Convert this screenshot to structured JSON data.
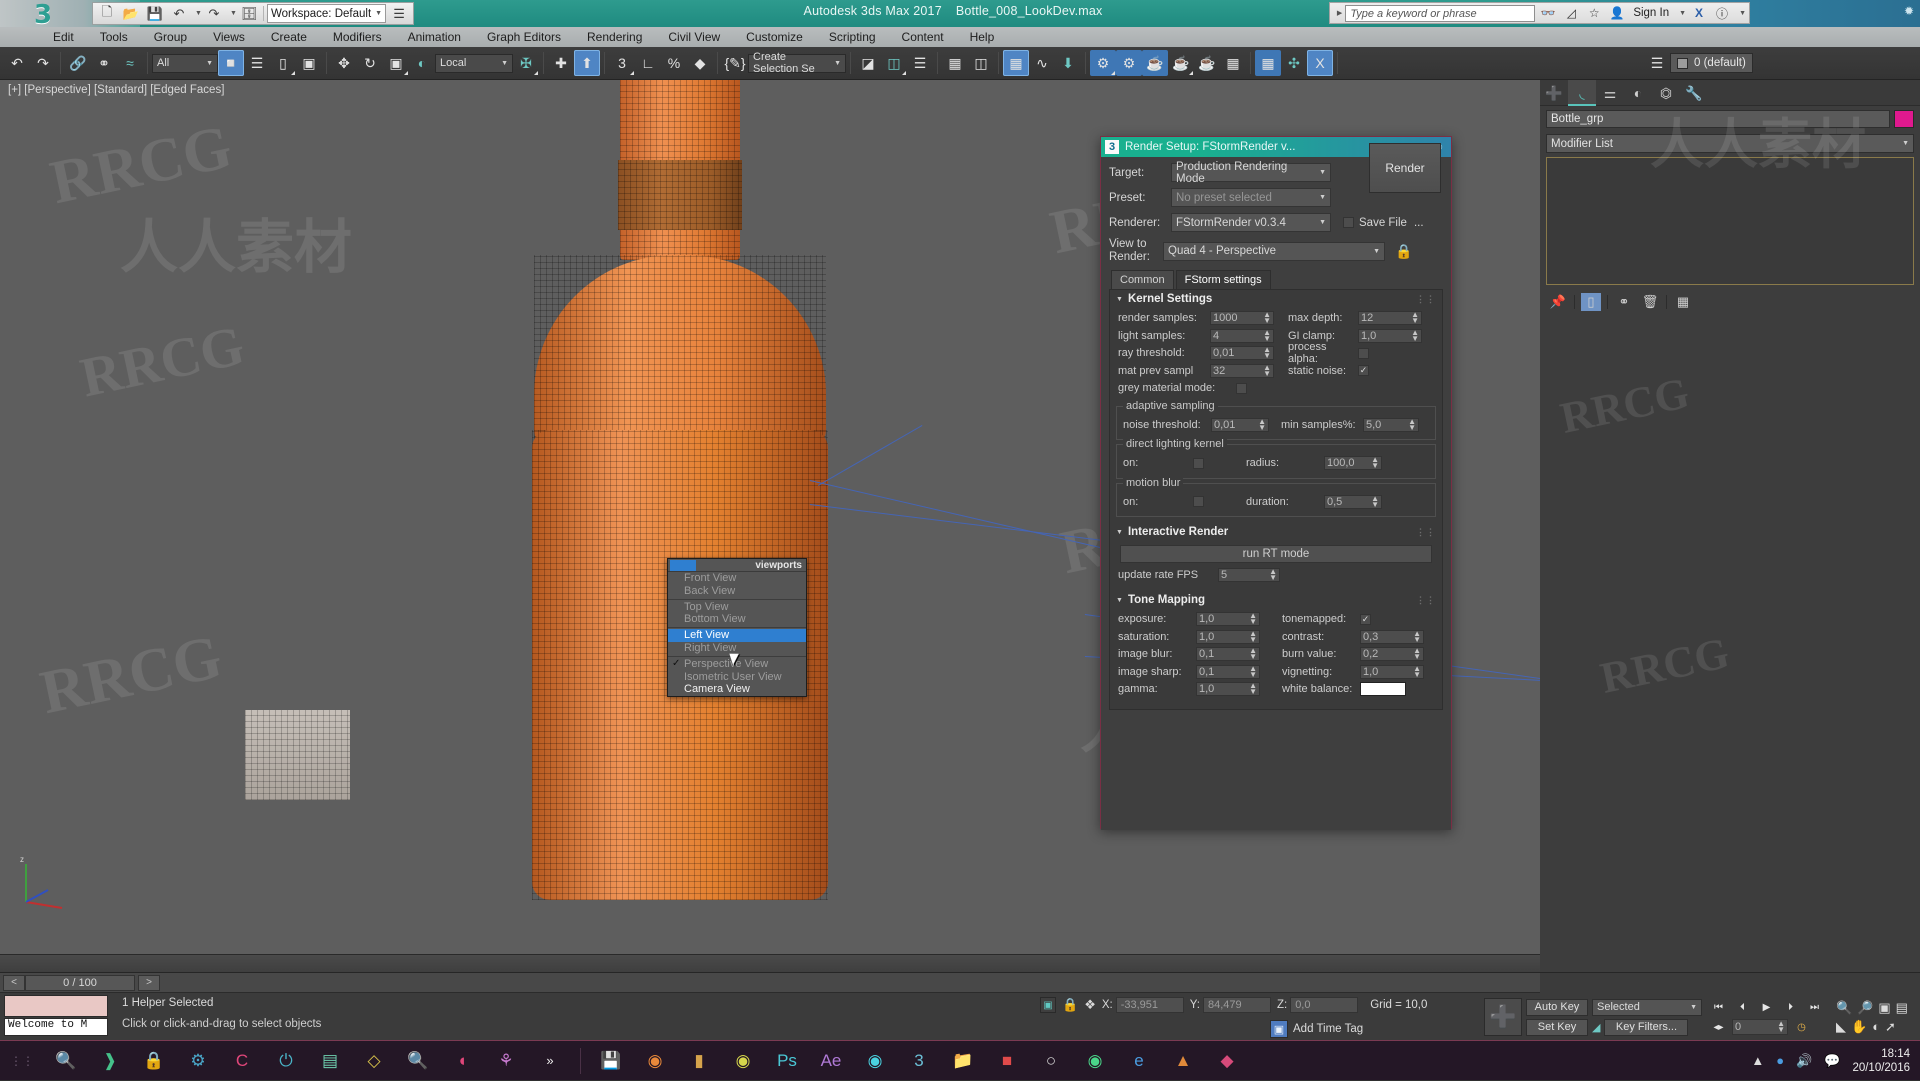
{
  "titlebar": {
    "app_title": "Autodesk 3ds Max 2017",
    "file_name": "Bottle_008_LookDev.max",
    "workspace": "Workspace: Default",
    "search_placeholder": "Type a keyword or phrase",
    "sign_in": "Sign In",
    "quick_access_icons": [
      "new-file-icon",
      "open-file-icon",
      "save-file-icon",
      "undo-icon",
      "redo-icon",
      "project-folder-icon"
    ],
    "header_icons": [
      "binoculars-icon",
      "autodesk-360-icon",
      "favorites-star-icon",
      "user-icon",
      "exchange-icon",
      "help-icon"
    ]
  },
  "menubar": {
    "items": [
      "Edit",
      "Tools",
      "Group",
      "Views",
      "Create",
      "Modifiers",
      "Animation",
      "Graph Editors",
      "Rendering",
      "Civil View",
      "Customize",
      "Scripting",
      "Content",
      "Help"
    ]
  },
  "toolbar": {
    "selection_filter": "All",
    "ref_coord_system": "Local",
    "named_selection_set": "Create Selection Se",
    "layer_name": "0 (default)"
  },
  "viewport": {
    "label": "[+] [Perspective] [Standard] [Edged Faces]",
    "context_menu": {
      "header": "viewports",
      "items": [
        {
          "label": "Front View",
          "state": "dim",
          "checked": false
        },
        {
          "label": "Back View",
          "state": "dim",
          "checked": false
        },
        {
          "label": "Top View",
          "state": "dim",
          "checked": false
        },
        {
          "label": "Bottom View",
          "state": "dim",
          "checked": false
        },
        {
          "label": "Left View",
          "state": "selected",
          "checked": false
        },
        {
          "label": "Right View",
          "state": "dim",
          "checked": false
        },
        {
          "label": "Perspective View",
          "state": "dim",
          "checked": true
        },
        {
          "label": "Isometric User View",
          "state": "dim",
          "checked": false
        },
        {
          "label": "Camera View",
          "state": "bright",
          "checked": false
        }
      ]
    }
  },
  "render_setup": {
    "title": "Render Setup: FStormRender v...",
    "target_label": "Target:",
    "target_value": "Production Rendering Mode",
    "preset_label": "Preset:",
    "preset_value": "No preset selected",
    "renderer_label": "Renderer:",
    "renderer_value": "FStormRender v0.3.4",
    "view_label": "View to Render:",
    "view_value": "Quad 4 - Perspective",
    "render_button": "Render",
    "save_file_label": "Save File",
    "save_file_ellipsis": "...",
    "tabs": [
      {
        "label": "Common",
        "active": false
      },
      {
        "label": "FStorm settings",
        "active": true
      }
    ],
    "kernel_settings": {
      "title": "Kernel Settings",
      "left": [
        {
          "label": "render samples:",
          "value": "1000"
        },
        {
          "label": "light samples:",
          "value": "4"
        },
        {
          "label": "ray threshold:",
          "value": "0,01"
        },
        {
          "label": "mat prev sampl",
          "value": "32"
        }
      ],
      "right": [
        {
          "label": "max depth:",
          "value": "12",
          "type": "spin"
        },
        {
          "label": "GI clamp:",
          "value": "1,0",
          "type": "spin"
        },
        {
          "label": "process alpha:",
          "value": "",
          "type": "check",
          "checked": false
        },
        {
          "label": "static noise:",
          "value": "",
          "type": "check",
          "checked": true
        }
      ],
      "grey_material_mode": {
        "label": "grey material mode:",
        "checked": false
      },
      "adaptive_sampling": {
        "title": "adaptive sampling",
        "noise_threshold_label": "noise threshold:",
        "noise_threshold_value": "0,01",
        "min_samples_label": "min samples%:",
        "min_samples_value": "5,0"
      },
      "direct_lighting_kernel": {
        "title": "direct lighting kernel",
        "on_label": "on:",
        "on_checked": false,
        "radius_label": "radius:",
        "radius_value": "100,0"
      },
      "motion_blur": {
        "title": "motion blur",
        "on_label": "on:",
        "on_checked": false,
        "duration_label": "duration:",
        "duration_value": "0,5"
      }
    },
    "interactive_render": {
      "title": "Interactive Render",
      "run_button": "run RT mode",
      "update_rate_label": "update rate FPS",
      "update_rate_value": "5"
    },
    "tone_mapping": {
      "title": "Tone Mapping",
      "left": [
        {
          "label": "exposure:",
          "value": "1,0"
        },
        {
          "label": "saturation:",
          "value": "1,0"
        },
        {
          "label": "image blur:",
          "value": "0,1"
        },
        {
          "label": "image sharp:",
          "value": "0,1"
        },
        {
          "label": "gamma:",
          "value": "1,0"
        }
      ],
      "right": [
        {
          "label": "tonemapped:",
          "value": "",
          "type": "check",
          "checked": true
        },
        {
          "label": "contrast:",
          "value": "0,3",
          "type": "spin"
        },
        {
          "label": "burn value:",
          "value": "0,2",
          "type": "spin"
        },
        {
          "label": "vignetting:",
          "value": "1,0",
          "type": "spin"
        },
        {
          "label": "white balance:",
          "value": "#ffffff",
          "type": "color"
        }
      ]
    }
  },
  "command_panel": {
    "tabs": [
      "create-tab",
      "modify-tab",
      "hierarchy-tab",
      "motion-tab",
      "display-tab",
      "utilities-tab"
    ],
    "object_name": "Bottle_grp",
    "object_color": "#e0198e",
    "modifier_list": "Modifier List",
    "stack_buttons": [
      "pin-stack-icon",
      "show-end-result-icon",
      "make-unique-icon",
      "remove-modifier-icon",
      "configure-sets-icon"
    ]
  },
  "status_bar": {
    "frame_indicator": "0 / 100",
    "mini_listener": "Welcome to M",
    "selection_status": "1 Helper Selected",
    "prompt": "Click or click-and-drag to select objects",
    "coord_x_label": "X:",
    "coord_x_value": "-33,951",
    "coord_y_label": "Y:",
    "coord_y_value": "84,479",
    "coord_z_label": "Z:",
    "coord_z_value": "0,0",
    "grid": "Grid = 10,0",
    "add_time_tag": "Add Time Tag",
    "auto_key": "Auto Key",
    "set_key": "Set Key",
    "key_mode": "Selected",
    "key_filters": "Key Filters...",
    "current_frame": "0"
  },
  "taskbar": {
    "time": "18:14",
    "date": "20/10/2016",
    "pinned": [
      "search-icon",
      "share-icon",
      "lock-icon",
      "sync-icon",
      "c-app-icon",
      "power-icon",
      "toolbox-icon",
      "diamond-icon",
      "magnifier-icon",
      "moon-icon",
      "network-icon"
    ],
    "overflow": "»",
    "apps": [
      "save-app-icon",
      "chrome-icon",
      "folder-icon",
      "after-effects-o-icon",
      "photoshop-icon",
      "after-effects-icon",
      "opera-icon",
      "three-ds-max-icon",
      "explorer-icon",
      "acrobat-icon",
      "maxon-icon",
      "spotify-icon",
      "edge-icon",
      "vlc-icon",
      "dropbox-icon"
    ],
    "tray": [
      "chevron-up-icon",
      "dropbox-tray-icon",
      "volume-icon",
      "notifications-icon"
    ]
  },
  "watermarks": [
    "RRCG",
    "人人素材"
  ]
}
